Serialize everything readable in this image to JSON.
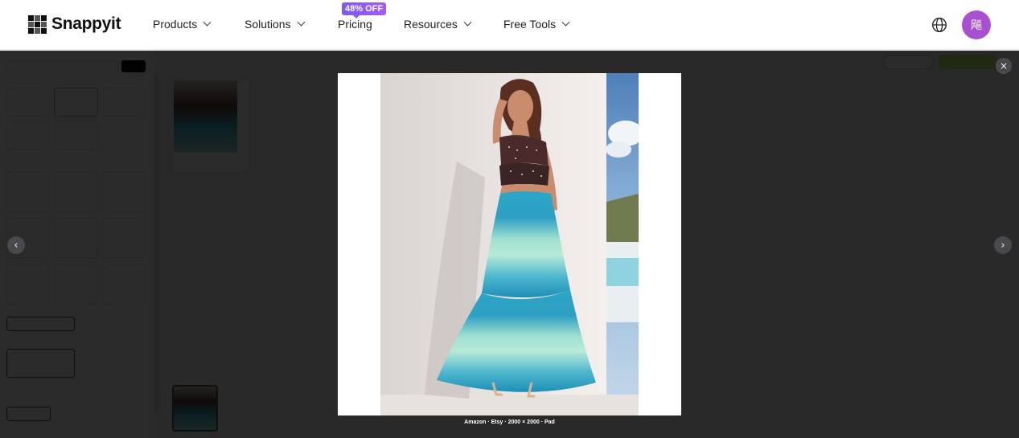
{
  "brand": {
    "name": "Snappyit"
  },
  "nav": {
    "items": [
      {
        "label": "Products",
        "dropdown": true
      },
      {
        "label": "Solutions",
        "dropdown": true
      },
      {
        "label": "Pricing",
        "dropdown": false
      },
      {
        "label": "Resources",
        "dropdown": true
      },
      {
        "label": "Free Tools",
        "dropdown": true
      }
    ],
    "pricing_badge": "48% OFF",
    "avatar_initial": "飚"
  },
  "lightbox": {
    "caption": "Amazon · Etsy · 2000 × 2000 · Pad",
    "close_glyph": "×",
    "prev_glyph": "‹",
    "next_glyph": "›"
  },
  "colors": {
    "accent": "#a84fd2",
    "badge": "#8b5cf3",
    "overlay": "rgba(0,0,0,0.83)",
    "lime": "#c8f16a"
  }
}
